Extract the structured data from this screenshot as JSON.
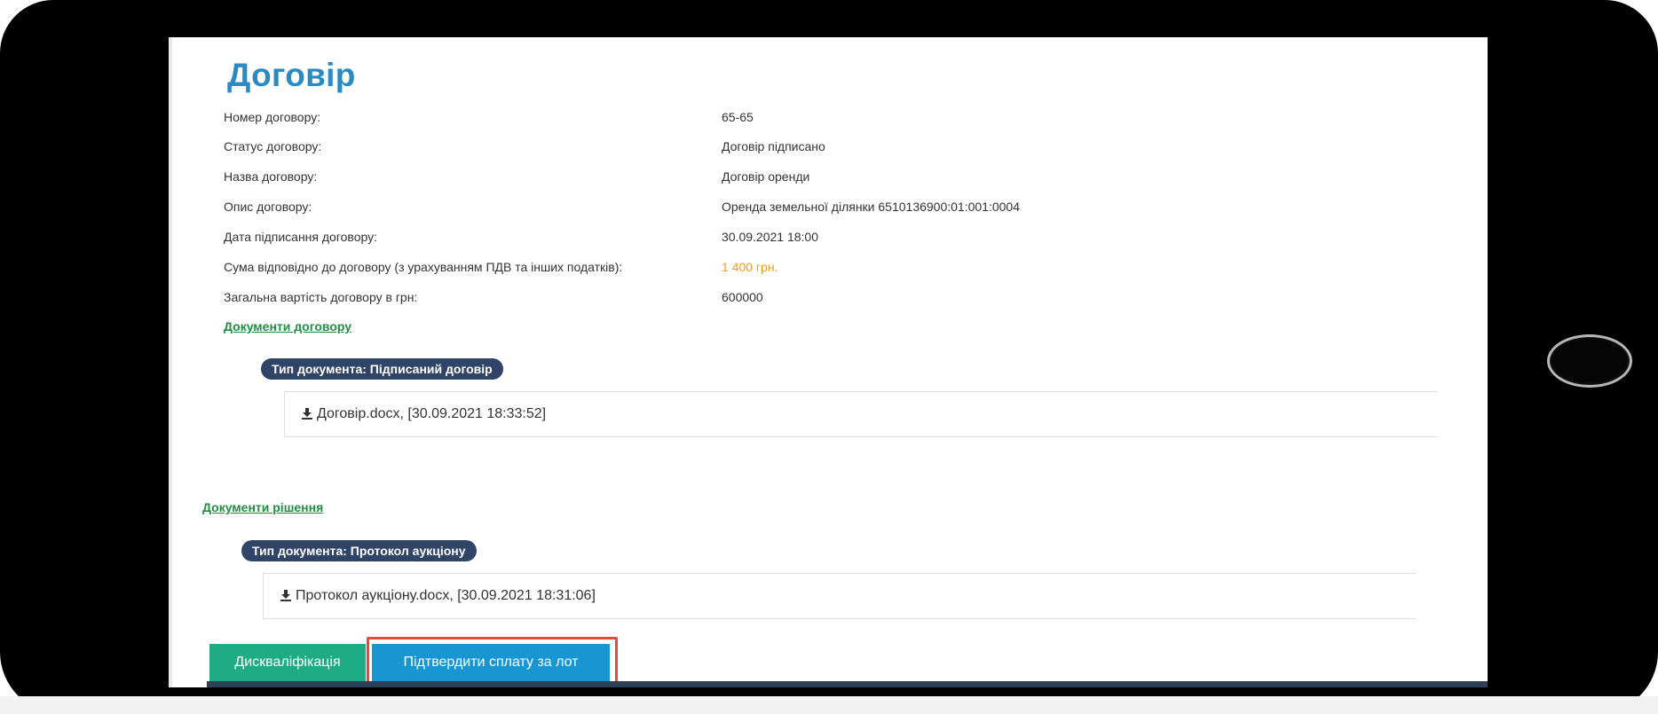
{
  "contract": {
    "title": "Договір",
    "fields": [
      {
        "label": "Номер договору:",
        "value": "65-65"
      },
      {
        "label": "Статус договору:",
        "value": "Договір підписано"
      },
      {
        "label": "Назва договору:",
        "value": "Договір оренди"
      },
      {
        "label": "Опис договору:",
        "value": "Оренда земельної ділянки 6510136900:01:001:0004"
      },
      {
        "label": "Дата підписання договору:",
        "value": "30.09.2021 18:00"
      },
      {
        "label": "Сума відповідно до договору (з урахуванням ПДВ та інших податків):",
        "value": "1 400 грн."
      },
      {
        "label": "Загальна вартість договору в грн:",
        "value": "600000"
      }
    ],
    "documents_link": "Документи договору",
    "doc_type": "Тип документа: Підписаний договір",
    "doc_entry": "Договір.docx, [30.09.2021 18:33:52]"
  },
  "decision": {
    "documents_link": "Документи рішення",
    "doc_type": "Тип документа: Протокол аукціону",
    "doc_entry": "Протокол аукціону.docx, [30.09.2021 18:31:06]"
  },
  "actions": {
    "disqualify": "Дискваліфікація",
    "confirm_payment": "Підтвердити сплату за лот"
  },
  "icons": {
    "download": "download-icon"
  },
  "colors": {
    "title": "#2b8ac1",
    "price": "#f19b1b",
    "link": "#1f8f3f",
    "badge": "#2f4466",
    "disqualify_button": "#1fab83",
    "confirm_button": "#1796d1",
    "highlight": "#e44a3b"
  }
}
